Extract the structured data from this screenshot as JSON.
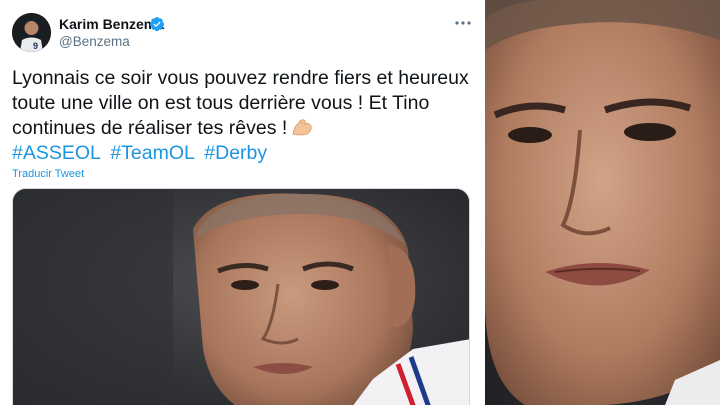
{
  "tweet": {
    "author_name": "Karim Benzema",
    "author_handle": "@Benzema",
    "text_lines": [
      "Lyonnais ce soir vous pouvez rendre fiers et heureux",
      "toute une ville on est tous derrière vous ! Et Tino",
      "continues de réaliser tes rêves !"
    ],
    "hashtags": [
      "#ASSEOL",
      "#TeamOL",
      "#Derby"
    ],
    "translate_label": "Traducir Tweet",
    "emoji": "flexed-biceps-icon",
    "avatar_jersey_number": "9"
  },
  "colors": {
    "link": "#1b95e0",
    "verified": "#1da1f2",
    "text": "#0f1419",
    "secondary": "#5b7083"
  }
}
